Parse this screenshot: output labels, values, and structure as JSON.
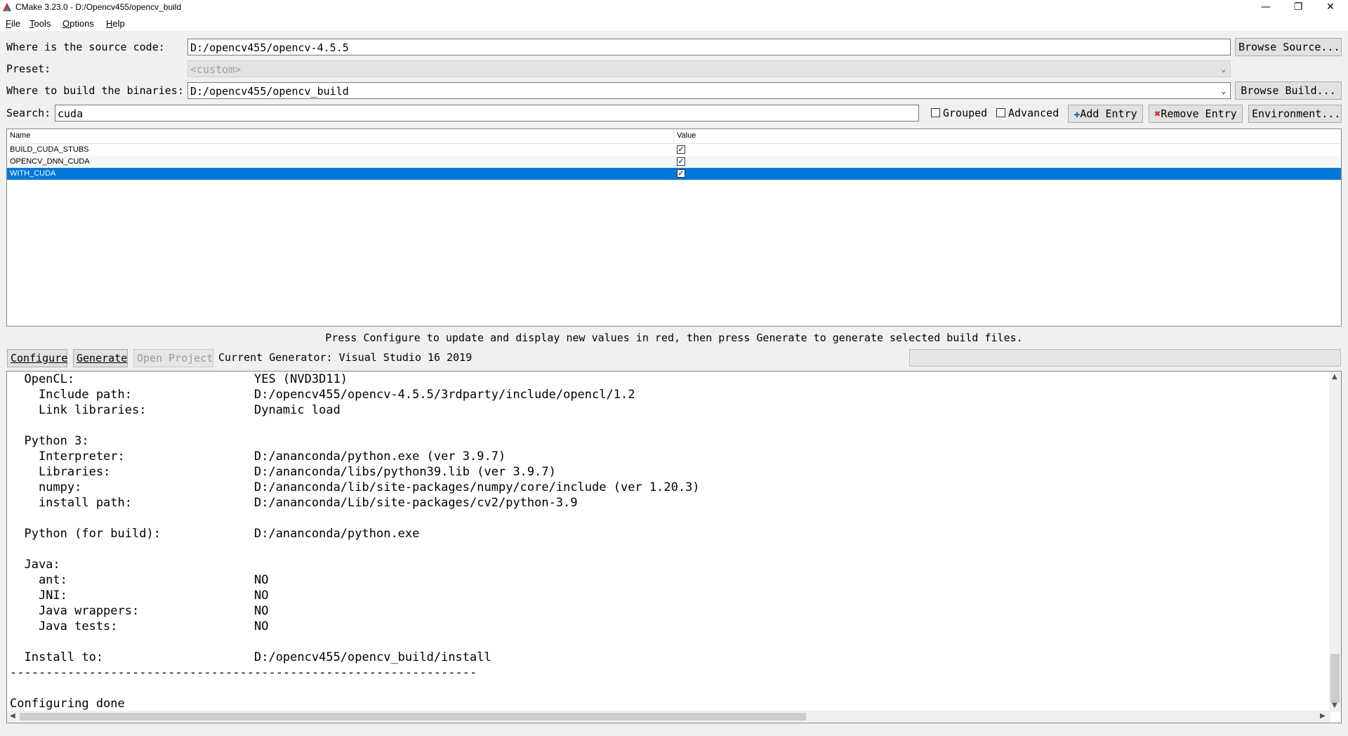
{
  "window": {
    "title": "CMake 3.23.0 - D:/Opencv455/opencv_build",
    "minimize_glyph": "—",
    "maximize_glyph": "❐",
    "close_glyph": "✕"
  },
  "menu": [
    {
      "first": "F",
      "rest": "ile"
    },
    {
      "first": "T",
      "rest": "ools"
    },
    {
      "first": "O",
      "rest": "ptions"
    },
    {
      "first": "H",
      "rest": "elp"
    }
  ],
  "source": {
    "label": "Where is the source code:",
    "value": "D:/opencv455/opencv-4.5.5",
    "browse_label": "Browse Source..."
  },
  "preset": {
    "label": "Preset:",
    "value": "<custom>"
  },
  "binaries": {
    "label": "Where to build the binaries:",
    "value": "D:/opencv455/opencv_build",
    "browse_label": "Browse Build..."
  },
  "search": {
    "label": "Search:",
    "value": "cuda"
  },
  "toggles": {
    "grouped": "Grouped",
    "advanced": "Advanced"
  },
  "entry_buttons": {
    "add": "Add Entry",
    "remove": "Remove Entry",
    "environment": "Environment..."
  },
  "cache_table": {
    "columns": [
      "Name",
      "Value"
    ],
    "rows": [
      {
        "name": "BUILD_CUDA_STUBS",
        "checked": true,
        "selected": false
      },
      {
        "name": "OPENCV_DNN_CUDA",
        "checked": true,
        "selected": false
      },
      {
        "name": "WITH_CUDA",
        "checked": true,
        "selected": true
      }
    ]
  },
  "hint_text": "Press Configure to update and display new values in red, then press Generate to generate selected build files.",
  "actions": {
    "configure": "Configure",
    "generate": "Generate",
    "open_project": "Open Project"
  },
  "generator_text": "Current Generator: Visual Studio 16 2019",
  "output_lines": [
    "  OpenCL:                         YES (NVD3D11)",
    "    Include path:                 D:/opencv455/opencv-4.5.5/3rdparty/include/opencl/1.2",
    "    Link libraries:               Dynamic load",
    "",
    "  Python 3:",
    "    Interpreter:                  D:/ananconda/python.exe (ver 3.9.7)",
    "    Libraries:                    D:/ananconda/libs/python39.lib (ver 3.9.7)",
    "    numpy:                        D:/ananconda/lib/site-packages/numpy/core/include (ver 1.20.3)",
    "    install path:                 D:/ananconda/Lib/site-packages/cv2/python-3.9",
    "",
    "  Python (for build):             D:/ananconda/python.exe",
    "",
    "  Java:",
    "    ant:                          NO",
    "    JNI:                          NO",
    "    Java wrappers:                NO",
    "    Java tests:                   NO",
    "",
    "  Install to:                     D:/opencv455/opencv_build/install",
    "-----------------------------------------------------------------",
    "",
    "Configuring done"
  ]
}
